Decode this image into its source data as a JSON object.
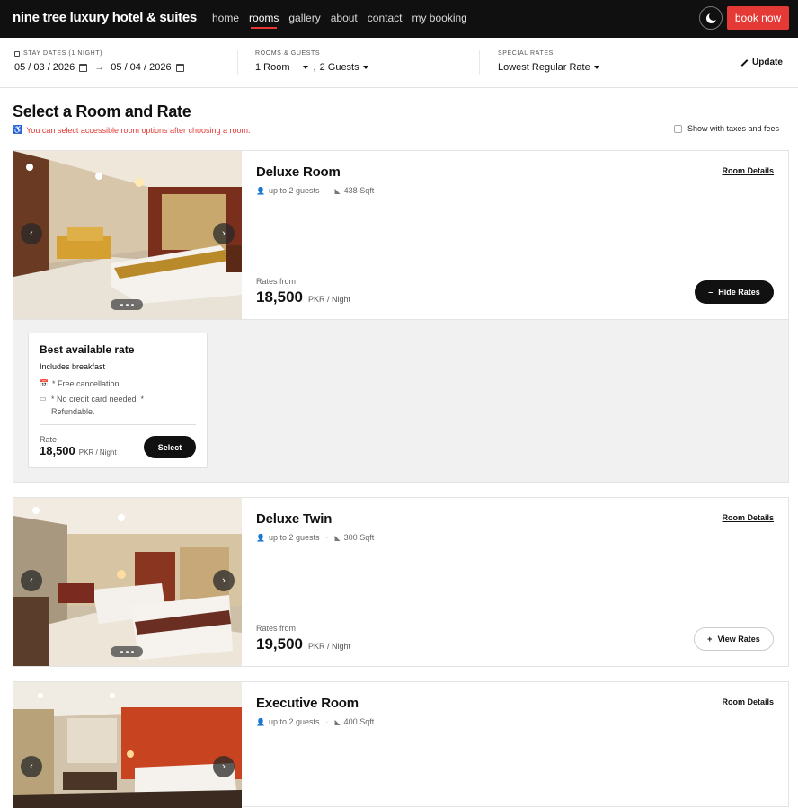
{
  "nav": {
    "brand": "nine tree luxury hotel & suites",
    "links": [
      "home",
      "rooms",
      "gallery",
      "about",
      "contact",
      "my booking"
    ],
    "active": "rooms",
    "book_now": "book now",
    "theme_icon": "moon-icon"
  },
  "search": {
    "stay_label": "STAY DATES (1 NIGHT)",
    "check_in": "05 / 03 / 2026",
    "arrow": "→",
    "check_out": "05 / 04 / 2026",
    "rooms_label": "ROOMS & GUESTS",
    "rooms_value": "1 Room",
    "guests_value": "2 Guests",
    "rates_label": "SPECIAL RATES",
    "rates_value": "Lowest Regular Rate",
    "update": "Update"
  },
  "heading": {
    "title": "Select a Room and Rate",
    "accessible_note": "You can select accessible room options after choosing a room.",
    "taxes_label": "Show with taxes and fees"
  },
  "rooms": [
    {
      "name": "Deluxe Room",
      "guests": "up to 2 guests",
      "size": "438 Sqft",
      "details_link": "Room Details",
      "rates_from": "Rates from",
      "price": "18,500",
      "unit": "PKR / Night",
      "rate_button": "Hide Rates",
      "rate_button_icon": "–"
    },
    {
      "name": "Deluxe Twin",
      "guests": "up to 2 guests",
      "size": "300 Sqft",
      "details_link": "Room Details",
      "rates_from": "Rates from",
      "price": "19,500",
      "unit": "PKR / Night",
      "rate_button": "View Rates",
      "rate_button_icon": "+"
    },
    {
      "name": "Executive Room",
      "guests": "up to 2 guests",
      "size": "400 Sqft",
      "details_link": "Room Details"
    }
  ],
  "rate_option": {
    "title": "Best available rate",
    "subtitle": "Includes breakfast",
    "feature_1": "* Free cancellation",
    "feature_2": "* No credit card needed. * Refundable.",
    "rate_label": "Rate",
    "price": "18,500",
    "unit": "PKR / Night",
    "select": "Select"
  },
  "colors": {
    "accent": "#e53935",
    "nav_bg": "#101010"
  }
}
